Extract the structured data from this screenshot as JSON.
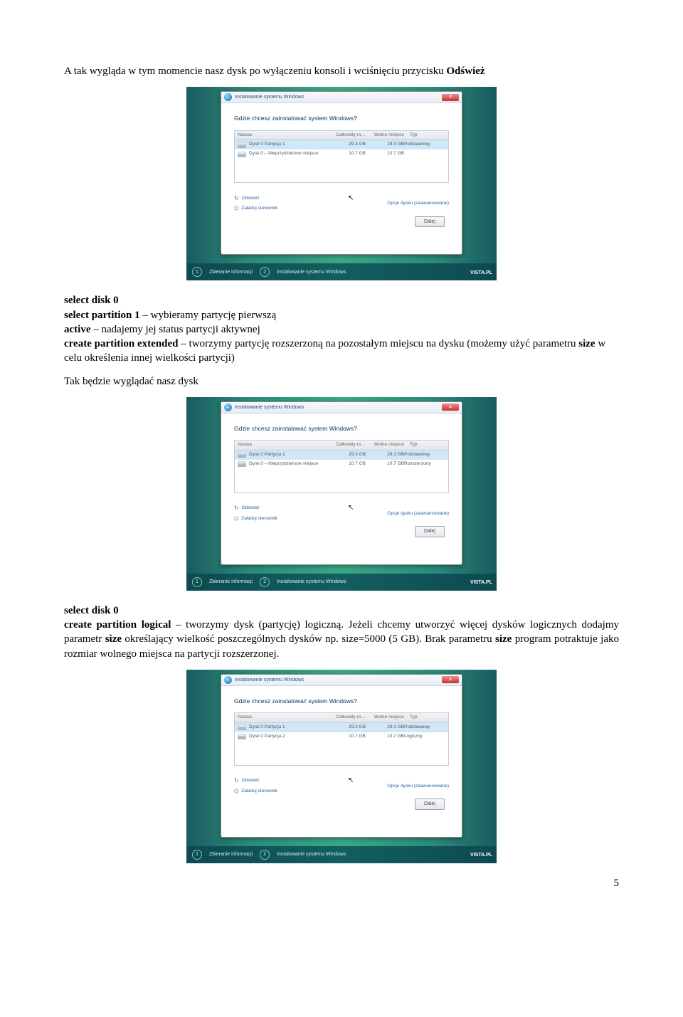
{
  "doc": {
    "p1": "A tak wygląda w tym momencie nasz dysk po wyłączeniu konsoli i wciśnięciu przycisku ",
    "p1_bold": "Odśwież",
    "cmd1_l1_a": "select disk 0",
    "cmd1_l2_a": "select partition 1",
    "cmd1_l2_b": " – wybieramy partycję pierwszą",
    "cmd1_l3_a": "active",
    "cmd1_l3_b": " – nadajemy jej status partycji aktywnej",
    "cmd1_l4_a": "create partition extended",
    "cmd1_l4_b": " – tworzymy partycję rozszerzoną na pozostałym miejscu na dysku (możemy użyć parametru ",
    "cmd1_l4_c": "size",
    "cmd1_l4_d": " w celu określenia innej wielkości partycji)",
    "p2": "Tak będzie wyglądać nasz dysk",
    "cmd2_l1_a": "select disk 0",
    "cmd2_l2_a": "create partition logical",
    "cmd2_l2_b": " – tworzymy dysk (partycję) logiczną. Jeżeli chcemy utworzyć więcej dysków logicznych dodajmy parametr ",
    "cmd2_l2_c": "size",
    "cmd2_l2_d": " określający wielkość poszczególnych dysków np. size=5000 (5 GB). Brak parametru ",
    "cmd2_l2_e": "size",
    "cmd2_l2_f": " program potraktuje jako rozmiar wolnego miejsca na partycji rozszerzonej.",
    "pagenum": "5"
  },
  "installer": {
    "title": "Instalowanie systemu Windows",
    "question": "Gdzie chcesz zainstalować system Windows?",
    "th_name": "Nazwa",
    "th_total": "Całkowity ro…",
    "th_free": "Wolne miejsce",
    "th_type": "Typ",
    "link_refresh": "Odśwież",
    "link_driver": "Załaduj sterownik",
    "link_adv": "Opcje dysku (zaawansowane)",
    "next": "Dalej",
    "step1": "1",
    "step1_label": "Zbieranie informacji",
    "step2": "2",
    "step2_label": "Instalowanie systemu Windows",
    "brand": "VISTA.PL"
  },
  "shot1": {
    "r1_name": "Dysk 0 Partycja 1",
    "r1_tot": "29.3 GB",
    "r1_free": "29.3 GB",
    "r1_type": "Podstawowy",
    "r2_name": "Dysk 0 – Nieprzydzielone miejsce",
    "r2_tot": "10.7 GB",
    "r2_free": "10.7 GB",
    "r2_type": ""
  },
  "shot2": {
    "r1_name": "Dysk 0 Partycja 1",
    "r1_tot": "29.3 GB",
    "r1_free": "29.3 GB",
    "r1_type": "Podstawowy",
    "r2_name": "Dysk 0 – Nieprzydzielone miejsce",
    "r2_tot": "10.7 GB",
    "r2_free": "10.7 GB",
    "r2_type": "Rozszerzony"
  },
  "shot3": {
    "r1_name": "Dysk 0 Partycja 1",
    "r1_tot": "29.3 GB",
    "r1_free": "29.3 GB",
    "r1_type": "Podstawowy",
    "r2_name": "Dysk 0 Partycja 2",
    "r2_tot": "10.7 GB",
    "r2_free": "10.7 GB",
    "r2_type": "Logiczny"
  }
}
